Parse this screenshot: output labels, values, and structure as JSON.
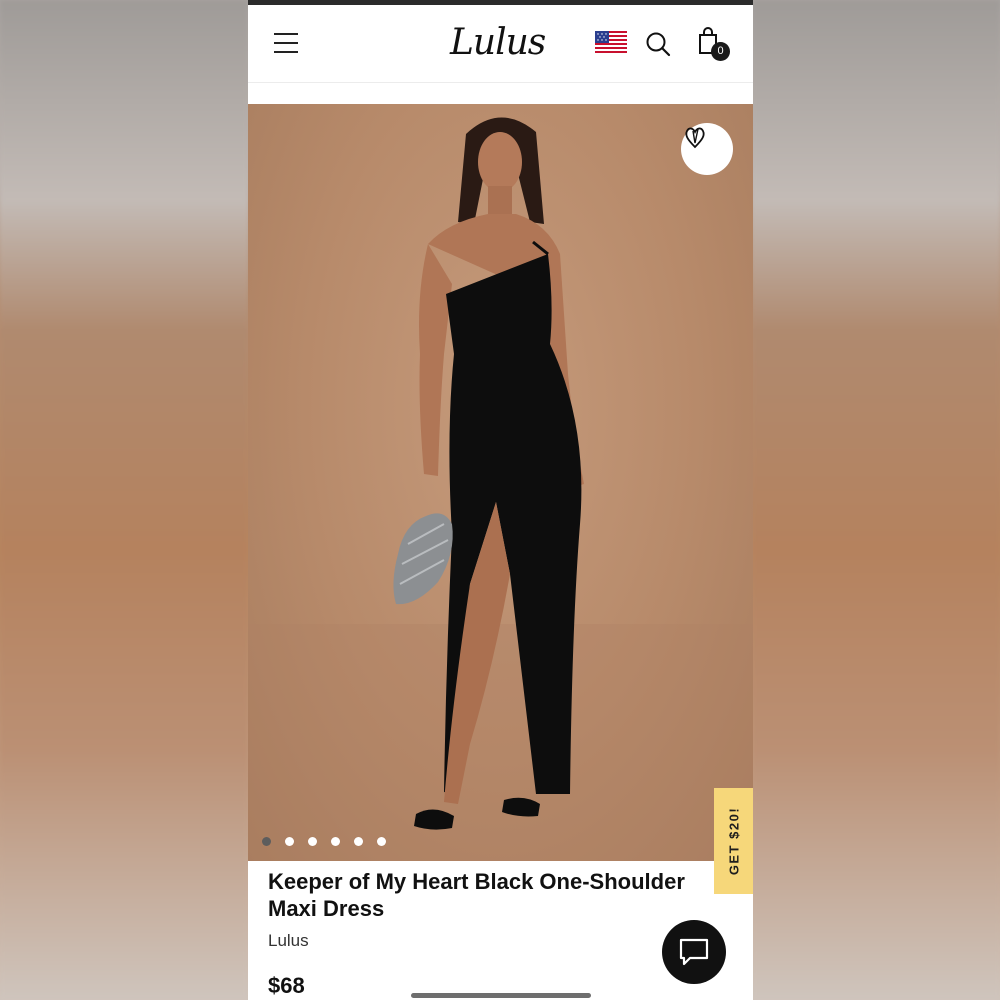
{
  "header": {
    "logo_text": "Lulus",
    "menu_icon": "hamburger-menu-icon",
    "flag_icon": "us-flag-icon",
    "search_icon": "search-icon",
    "cart_icon": "shopping-bag-icon",
    "cart_count": "0"
  },
  "gallery": {
    "wishlist_icon": "heart-icon",
    "image_count": 6,
    "active_index": 0
  },
  "promo": {
    "label": "GET $20!",
    "color": "#f6d77a"
  },
  "product": {
    "title": "Keeper of My Heart Black One-Shoulder Maxi Dress",
    "brand": "Lulus",
    "price": "$68"
  },
  "chat": {
    "icon": "chat-bubble-icon"
  },
  "colors": {
    "image_background": "#b78a6a",
    "dress": "#0d0d0d",
    "text": "#111111"
  }
}
